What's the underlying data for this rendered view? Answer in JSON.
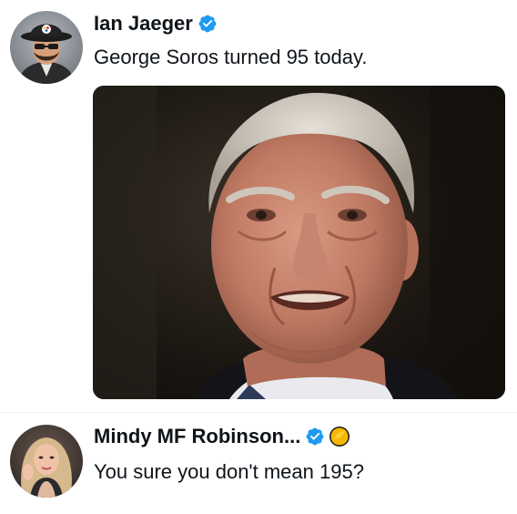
{
  "post1": {
    "author_name": "Ian Jaeger",
    "text": "George Soros turned 95 today.",
    "verified_icon": "verified-badge-icon",
    "avatar_icon": "avatar-photo",
    "media_icon": "portrait-photo"
  },
  "post2": {
    "author_name": "Mindy MF Robinson...",
    "text": "You sure you don't mean 195?",
    "verified_icon": "verified-badge-icon",
    "extra_badge_icon": "gold-badge-icon",
    "avatar_icon": "avatar-photo"
  },
  "colors": {
    "verified_blue": "#1d9bf0",
    "gold": "#f5b800",
    "text": "#0f1419"
  }
}
